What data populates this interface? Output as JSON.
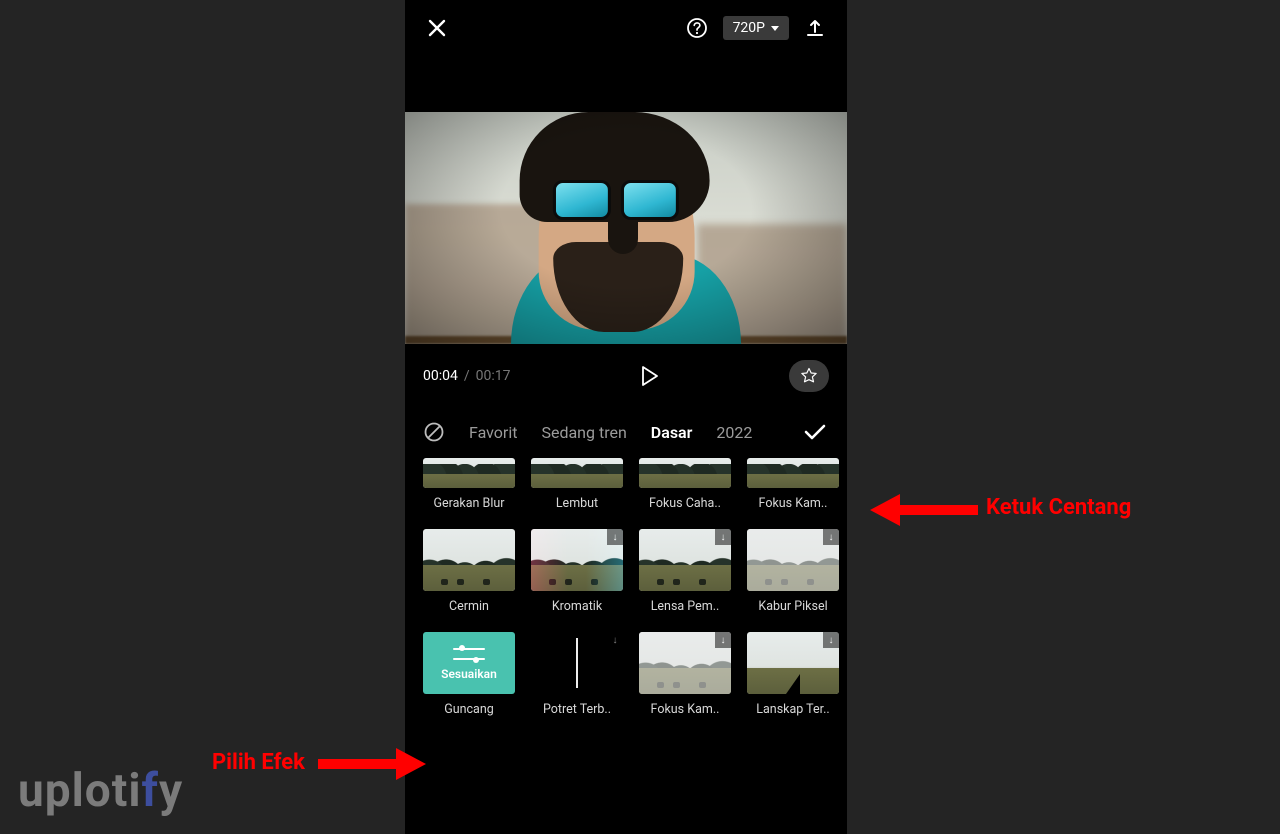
{
  "header": {
    "resolution_label": "720P"
  },
  "transport": {
    "current_time": "00:04",
    "separator": "/",
    "duration": "00:17"
  },
  "tabs": {
    "items": [
      {
        "label": "Favorit",
        "active": false
      },
      {
        "label": "Sedang tren",
        "active": false
      },
      {
        "label": "Dasar",
        "active": true
      },
      {
        "label": "2022",
        "active": false
      }
    ]
  },
  "effects": {
    "row1": [
      {
        "label": "Gerakan Blur"
      },
      {
        "label": "Lembut"
      },
      {
        "label": "Fokus Caha.."
      },
      {
        "label": "Fokus Kam.."
      }
    ],
    "row2": [
      {
        "label": "Cermin"
      },
      {
        "label": "Kromatik"
      },
      {
        "label": "Lensa Pem.."
      },
      {
        "label": "Kabur Piksel"
      }
    ],
    "row3": [
      {
        "label": "Guncang",
        "adjust_label": "Sesuaikan"
      },
      {
        "label": "Potret Terb.."
      },
      {
        "label": "Fokus Kam.."
      },
      {
        "label": "Lanskap Ter.."
      }
    ]
  },
  "annotations": {
    "right_label": "Ketuk Centang",
    "left_label": "Pilih Efek"
  },
  "watermark": {
    "pre": "uploti",
    "accent": "f",
    "post": "y"
  },
  "colors": {
    "annotation": "#f00",
    "adjust_tile": "#49c2af"
  }
}
